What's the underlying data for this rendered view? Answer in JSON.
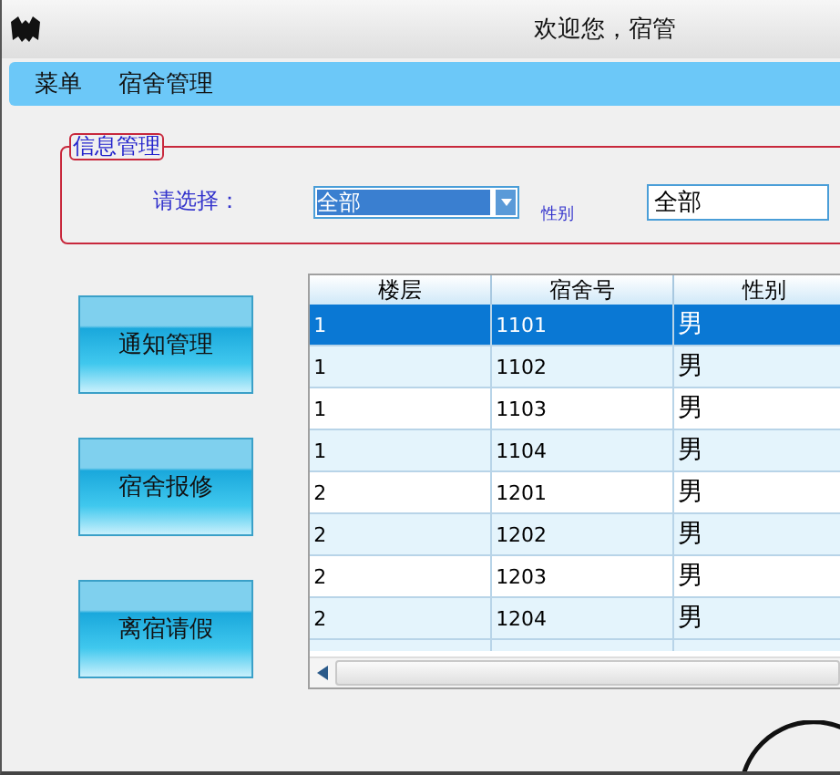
{
  "window": {
    "title": "欢迎您，宿管"
  },
  "menu": [
    {
      "label": "菜单"
    },
    {
      "label": "宿舍管理"
    }
  ],
  "filter": {
    "legend": "信息管理",
    "label": "请选择：",
    "select_value": "全部",
    "gender_label": "性别",
    "gender_value": "全部"
  },
  "buttons": [
    "通知管理",
    "宿舍报修",
    "离宿请假"
  ],
  "table": {
    "columns": [
      "楼层",
      "宿舍号",
      "性别"
    ],
    "rows": [
      {
        "cells": [
          "1",
          "1101",
          "男"
        ],
        "selected": true
      },
      {
        "cells": [
          "1",
          "1102",
          "男"
        ],
        "selected": false
      },
      {
        "cells": [
          "1",
          "1103",
          "男"
        ],
        "selected": false
      },
      {
        "cells": [
          "1",
          "1104",
          "男"
        ],
        "selected": false
      },
      {
        "cells": [
          "2",
          "1201",
          "男"
        ],
        "selected": false
      },
      {
        "cells": [
          "2",
          "1202",
          "男"
        ],
        "selected": false
      },
      {
        "cells": [
          "2",
          "1203",
          "男"
        ],
        "selected": false
      },
      {
        "cells": [
          "2",
          "1204",
          "男"
        ],
        "selected": false
      }
    ]
  }
}
